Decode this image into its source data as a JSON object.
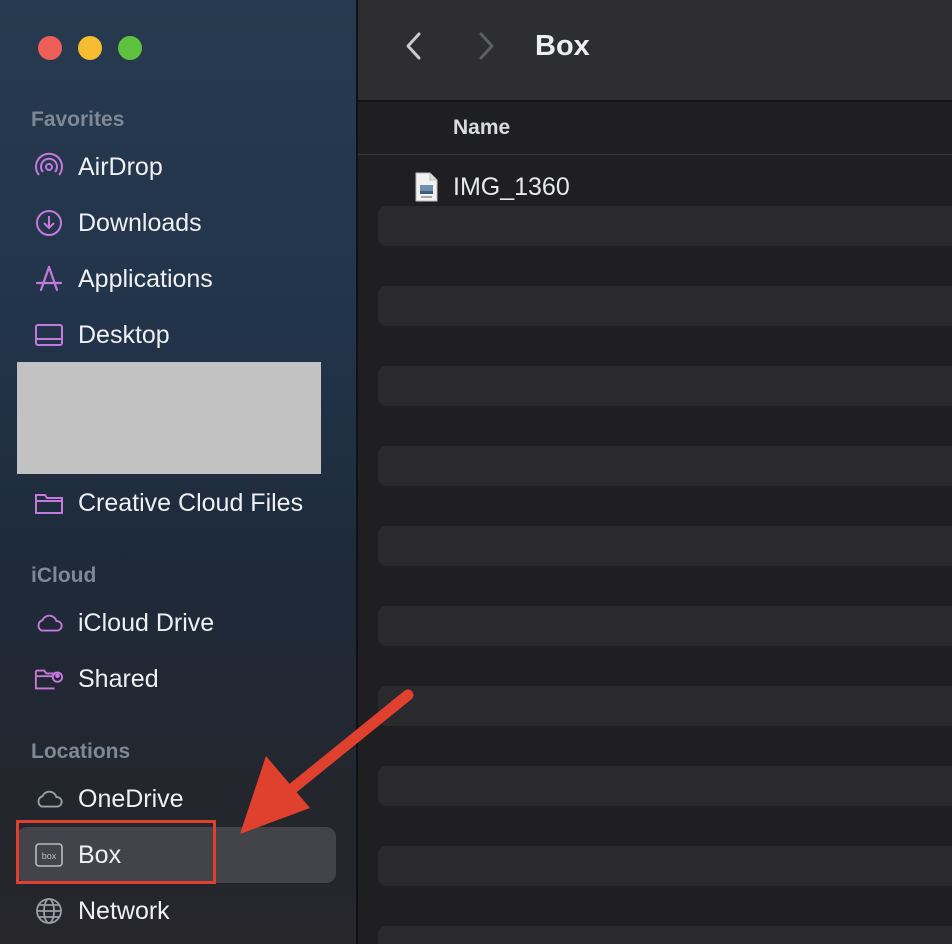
{
  "window": {
    "title": "Box"
  },
  "sidebar": {
    "sections": {
      "favorites": "Favorites",
      "icloud": "iCloud",
      "locations": "Locations"
    },
    "favorites": [
      {
        "label": "AirDrop",
        "icon": "airdrop-icon"
      },
      {
        "label": "Downloads",
        "icon": "download-icon"
      },
      {
        "label": "Applications",
        "icon": "applications-icon"
      },
      {
        "label": "Desktop",
        "icon": "desktop-icon"
      },
      {
        "label": "Creative Cloud Files",
        "icon": "folder-icon"
      }
    ],
    "icloud": [
      {
        "label": "iCloud Drive",
        "icon": "cloud-icon"
      },
      {
        "label": "Shared",
        "icon": "shared-folder-icon"
      }
    ],
    "locations": [
      {
        "label": "OneDrive",
        "icon": "cloud-icon"
      },
      {
        "label": "Box",
        "icon": "box-icon",
        "selected": true
      },
      {
        "label": "Network",
        "icon": "globe-icon"
      }
    ],
    "accent_color": "#c678dd"
  },
  "main": {
    "column_header": "Name",
    "files": [
      {
        "name": "IMG_1360",
        "icon": "image-file-icon"
      }
    ]
  },
  "annotation": {
    "color": "#e0402e",
    "icon": "red-arrow-icon"
  }
}
